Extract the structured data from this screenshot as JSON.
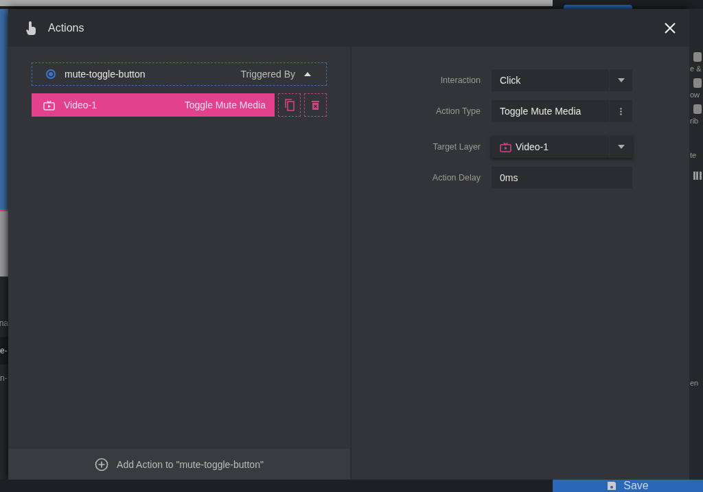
{
  "window": {
    "title": "Actions"
  },
  "trigger": {
    "layer": "mute-toggle-button",
    "selected": true,
    "label": "Triggered By",
    "expanded": true
  },
  "actions": [
    {
      "layer": "Video-1",
      "action": "Toggle Mute Media",
      "selected": true
    }
  ],
  "add_action": "Add Action to \"mute-toggle-button\"",
  "fields": [
    {
      "label": "Interaction",
      "value": "Click",
      "kind": "dropdown"
    },
    {
      "label": "Action Type",
      "value": "Toggle Mute Media",
      "kind": "menu"
    },
    {
      "label": "Target Layer",
      "value": "Video-1",
      "kind": "layer"
    },
    {
      "label": "Action Delay",
      "value": "0ms",
      "kind": "text"
    }
  ],
  "background": {
    "left_fragments": [
      "na",
      "e-",
      "n-"
    ],
    "right_fragments": [
      "e &",
      "ow",
      "rib",
      "te",
      "en"
    ],
    "save_button": "Save"
  }
}
